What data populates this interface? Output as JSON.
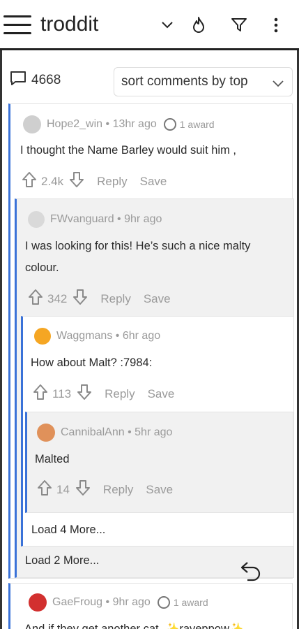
{
  "app": {
    "title": "troddit"
  },
  "comments_count": "4668",
  "sort": {
    "label": "sort comments by top"
  },
  "comments": [
    {
      "user": "Hope2_win",
      "time": "13hr ago",
      "award": "1 award",
      "body": "I thought the Name Barley would suit him ,",
      "score": "2.4k",
      "reply": "Reply",
      "save": "Save"
    },
    {
      "user": "FWvanguard",
      "time": "9hr ago",
      "body": "I was looking for this! He’s such a nice malty colour.",
      "score": "342",
      "reply": "Reply",
      "save": "Save"
    },
    {
      "user": "Waggmans",
      "time": "6hr ago",
      "body": "How about Malt? :7984:",
      "score": "113",
      "reply": "Reply",
      "save": "Save"
    },
    {
      "user": "CannibalAnn",
      "time": "5hr ago",
      "body": "Malted",
      "score": "14",
      "reply": "Reply",
      "save": "Save"
    },
    {
      "user": "GaeFroug",
      "time": "9hr ago",
      "award": "1 award",
      "body": "And if they get another cat, ✨raveppow✨"
    }
  ],
  "load_more": [
    "Load 4 More...",
    "Load 2 More..."
  ],
  "separator": "•",
  "colors": {
    "thread_line": "#3a72d8",
    "alt_bg": "#f1f1f1"
  }
}
